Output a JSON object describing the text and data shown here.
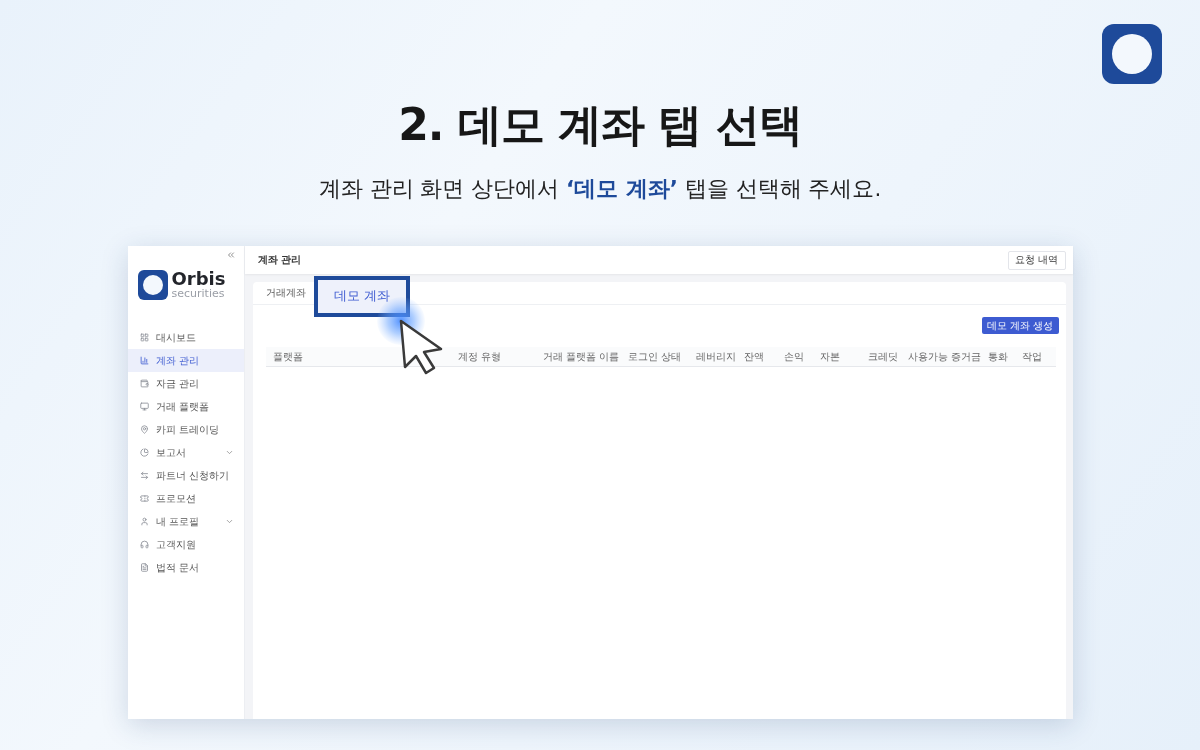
{
  "heading": {
    "title": "2. 데모 계좌 탭 선택",
    "subtitle": "계좌 관리 화면 상단에서 **‘데모 계좌’** 탭을 선택해 주세요."
  },
  "sidebar": {
    "logo": {
      "name": "Orbis",
      "tagline": "securities"
    },
    "items": [
      {
        "label": "대시보드",
        "selected": false,
        "expandable": false
      },
      {
        "label": "계좌 관리",
        "selected": true,
        "expandable": false
      },
      {
        "label": "자금 관리",
        "selected": false,
        "expandable": false
      },
      {
        "label": "거래 플랫폼",
        "selected": false,
        "expandable": false
      },
      {
        "label": "카피 트레이딩",
        "selected": false,
        "expandable": false
      },
      {
        "label": "보고서",
        "selected": false,
        "expandable": true
      },
      {
        "label": "파트너 신청하기",
        "selected": false,
        "expandable": false
      },
      {
        "label": "프로모션",
        "selected": false,
        "expandable": false
      },
      {
        "label": "내 프로필",
        "selected": false,
        "expandable": true
      },
      {
        "label": "고객지원",
        "selected": false,
        "expandable": false
      },
      {
        "label": "법적 문서",
        "selected": false,
        "expandable": false
      }
    ]
  },
  "header": {
    "title": "계좌 관리",
    "button": "요청 내역"
  },
  "tabs": [
    {
      "label": "거래계좌",
      "selected": false,
      "highlighted": false
    },
    {
      "label": "데모 계좌",
      "selected": true,
      "highlighted": true
    }
  ],
  "create_button": "데모 계좌 생성",
  "table": {
    "columns": [
      "플랫폼",
      "계정 유형",
      "거래 플랫폼 이름",
      "로그인 상태",
      "레버리지",
      "잔액",
      "손익",
      "자본",
      "크레딧",
      "사용가능 증거금",
      "통화",
      "작업"
    ]
  }
}
